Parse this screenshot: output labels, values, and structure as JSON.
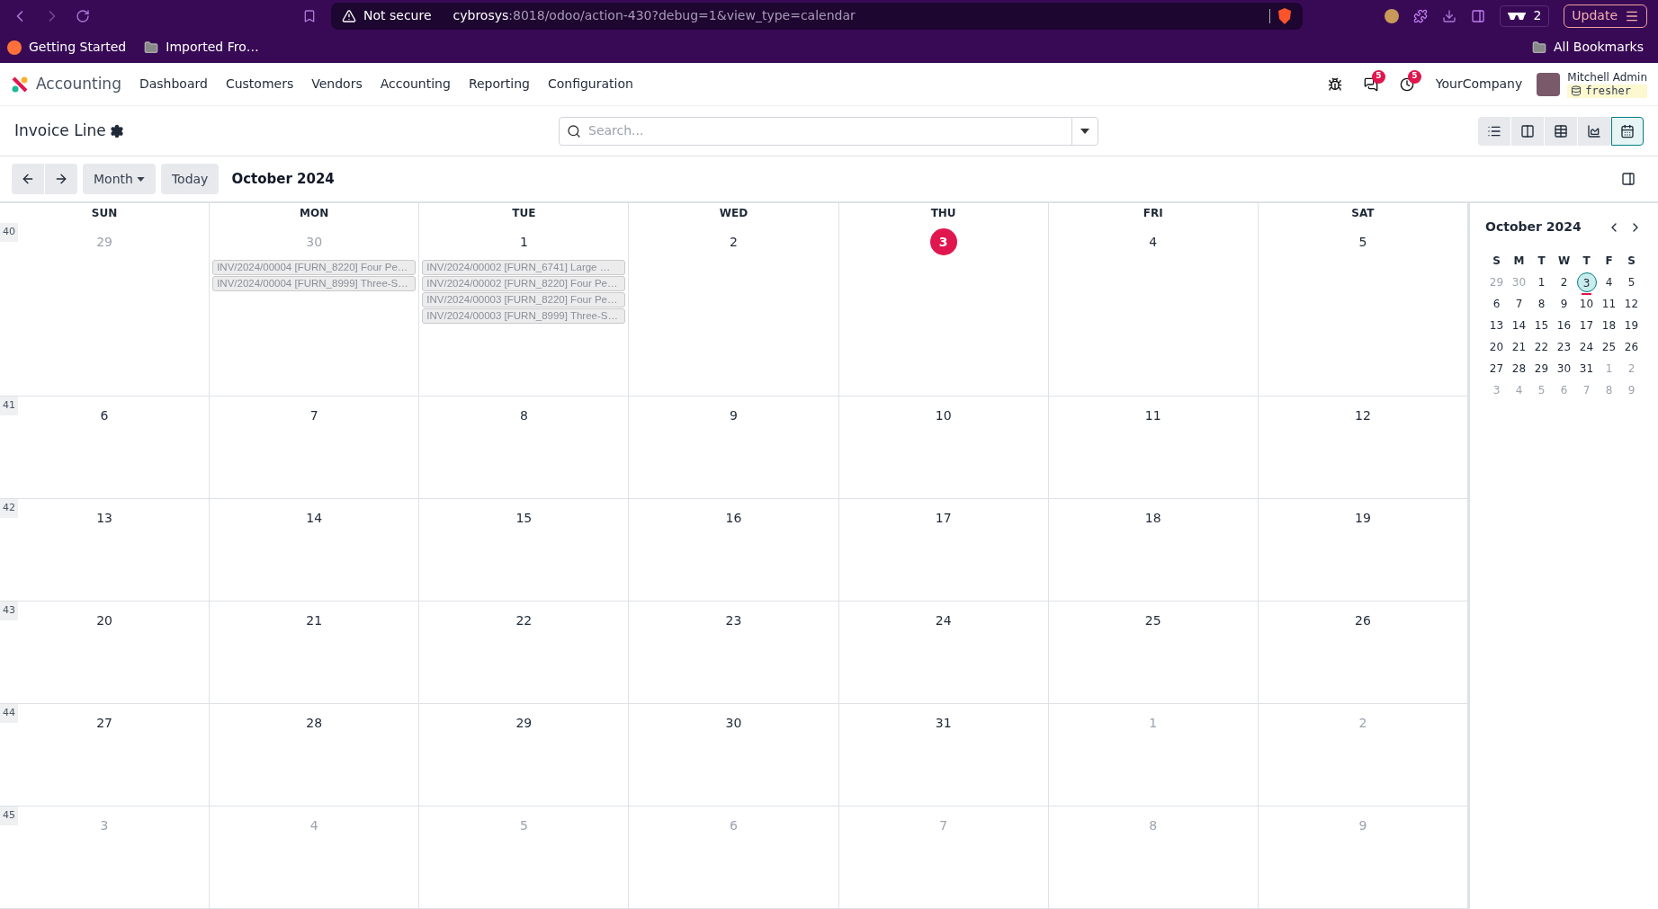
{
  "browser": {
    "security": "Not secure",
    "url_host": "cybrosys",
    "url_rest": ":8018/odoo/action-430?debug=1&view_type=calendar",
    "extension_count": "2",
    "update": "Update",
    "bookmarks": [
      "Getting Started",
      "Imported Fro…"
    ],
    "all_bookmarks": "All Bookmarks"
  },
  "navbar": {
    "app": "Accounting",
    "menus": [
      "Dashboard",
      "Customers",
      "Vendors",
      "Accounting",
      "Reporting",
      "Configuration"
    ],
    "messages_count": "5",
    "activities_count": "5",
    "company": "YourCompany",
    "user": "Mitchell Admin",
    "database": "fresher"
  },
  "control_panel": {
    "title": "Invoice Line",
    "search": {
      "placeholder": "Search..."
    },
    "views": [
      {
        "kind": "list",
        "selected": false
      },
      {
        "kind": "kanban",
        "selected": false
      },
      {
        "kind": "pivot",
        "selected": false
      },
      {
        "kind": "graph",
        "selected": false
      },
      {
        "kind": "calendar",
        "selected": true
      }
    ]
  },
  "toolbar": {
    "scale": "Month",
    "today": "Today",
    "period": "October 2024"
  },
  "calendar": {
    "weekdays": [
      "SUN",
      "MON",
      "TUE",
      "WED",
      "THU",
      "FRI",
      "SAT"
    ],
    "weeks": [
      {
        "number": "40",
        "days": [
          {
            "day": "29",
            "in_month": false,
            "today": false
          },
          {
            "day": "30",
            "in_month": false,
            "today": false,
            "events": [
              "INV/2024/00004 [FURN_8220] Four Pe…",
              "INV/2024/00004 [FURN_8999] Three-S…"
            ]
          },
          {
            "day": "1",
            "in_month": true,
            "today": false,
            "events": [
              "INV/2024/00002 [FURN_6741] Large …",
              "INV/2024/00002 [FURN_8220] Four Pe…",
              "INV/2024/00003 [FURN_8220] Four Pe…",
              "INV/2024/00003 [FURN_8999] Three-S…"
            ]
          },
          {
            "day": "2",
            "in_month": true,
            "today": false
          },
          {
            "day": "3",
            "in_month": true,
            "today": true
          },
          {
            "day": "4",
            "in_month": true,
            "today": false
          },
          {
            "day": "5",
            "in_month": true,
            "today": false
          }
        ]
      },
      {
        "number": "41",
        "days": [
          {
            "day": "6",
            "in_month": true,
            "today": false
          },
          {
            "day": "7",
            "in_month": true,
            "today": false
          },
          {
            "day": "8",
            "in_month": true,
            "today": false
          },
          {
            "day": "9",
            "in_month": true,
            "today": false
          },
          {
            "day": "10",
            "in_month": true,
            "today": false
          },
          {
            "day": "11",
            "in_month": true,
            "today": false
          },
          {
            "day": "12",
            "in_month": true,
            "today": false
          }
        ]
      },
      {
        "number": "42",
        "days": [
          {
            "day": "13",
            "in_month": true,
            "today": false
          },
          {
            "day": "14",
            "in_month": true,
            "today": false
          },
          {
            "day": "15",
            "in_month": true,
            "today": false
          },
          {
            "day": "16",
            "in_month": true,
            "today": false
          },
          {
            "day": "17",
            "in_month": true,
            "today": false
          },
          {
            "day": "18",
            "in_month": true,
            "today": false
          },
          {
            "day": "19",
            "in_month": true,
            "today": false
          }
        ]
      },
      {
        "number": "43",
        "days": [
          {
            "day": "20",
            "in_month": true,
            "today": false
          },
          {
            "day": "21",
            "in_month": true,
            "today": false
          },
          {
            "day": "22",
            "in_month": true,
            "today": false
          },
          {
            "day": "23",
            "in_month": true,
            "today": false
          },
          {
            "day": "24",
            "in_month": true,
            "today": false
          },
          {
            "day": "25",
            "in_month": true,
            "today": false
          },
          {
            "day": "26",
            "in_month": true,
            "today": false
          }
        ]
      },
      {
        "number": "44",
        "days": [
          {
            "day": "27",
            "in_month": true,
            "today": false
          },
          {
            "day": "28",
            "in_month": true,
            "today": false
          },
          {
            "day": "29",
            "in_month": true,
            "today": false
          },
          {
            "day": "30",
            "in_month": true,
            "today": false
          },
          {
            "day": "31",
            "in_month": true,
            "today": false
          },
          {
            "day": "1",
            "in_month": false,
            "today": false
          },
          {
            "day": "2",
            "in_month": false,
            "today": false
          }
        ]
      },
      {
        "number": "45",
        "days": [
          {
            "day": "3",
            "in_month": false,
            "today": false
          },
          {
            "day": "4",
            "in_month": false,
            "today": false
          },
          {
            "day": "5",
            "in_month": false,
            "today": false
          },
          {
            "day": "6",
            "in_month": false,
            "today": false
          },
          {
            "day": "7",
            "in_month": false,
            "today": false
          },
          {
            "day": "8",
            "in_month": false,
            "today": false
          },
          {
            "day": "9",
            "in_month": false,
            "today": false
          }
        ]
      }
    ]
  },
  "mini_calendar": {
    "title": "October 2024",
    "weekdays": [
      "S",
      "M",
      "T",
      "W",
      "T",
      "F",
      "S"
    ],
    "weeks": [
      [
        {
          "day": "29",
          "in_month": false,
          "selected": false,
          "today": false
        },
        {
          "day": "30",
          "in_month": false,
          "selected": false,
          "today": false
        },
        {
          "day": "1",
          "in_month": true,
          "selected": false,
          "today": false
        },
        {
          "day": "2",
          "in_month": true,
          "selected": false,
          "today": false
        },
        {
          "day": "3",
          "in_month": true,
          "selected": true,
          "today": true
        },
        {
          "day": "4",
          "in_month": true,
          "selected": false,
          "today": false
        },
        {
          "day": "5",
          "in_month": true,
          "selected": false,
          "today": false
        }
      ],
      [
        {
          "day": "6",
          "in_month": true,
          "selected": false,
          "today": false
        },
        {
          "day": "7",
          "in_month": true,
          "selected": false,
          "today": false
        },
        {
          "day": "8",
          "in_month": true,
          "selected": false,
          "today": false
        },
        {
          "day": "9",
          "in_month": true,
          "selected": false,
          "today": false
        },
        {
          "day": "10",
          "in_month": true,
          "selected": false,
          "today": false
        },
        {
          "day": "11",
          "in_month": true,
          "selected": false,
          "today": false
        },
        {
          "day": "12",
          "in_month": true,
          "selected": false,
          "today": false
        }
      ],
      [
        {
          "day": "13",
          "in_month": true,
          "selected": false,
          "today": false
        },
        {
          "day": "14",
          "in_month": true,
          "selected": false,
          "today": false
        },
        {
          "day": "15",
          "in_month": true,
          "selected": false,
          "today": false
        },
        {
          "day": "16",
          "in_month": true,
          "selected": false,
          "today": false
        },
        {
          "day": "17",
          "in_month": true,
          "selected": false,
          "today": false
        },
        {
          "day": "18",
          "in_month": true,
          "selected": false,
          "today": false
        },
        {
          "day": "19",
          "in_month": true,
          "selected": false,
          "today": false
        }
      ],
      [
        {
          "day": "20",
          "in_month": true,
          "selected": false,
          "today": false
        },
        {
          "day": "21",
          "in_month": true,
          "selected": false,
          "today": false
        },
        {
          "day": "22",
          "in_month": true,
          "selected": false,
          "today": false
        },
        {
          "day": "23",
          "in_month": true,
          "selected": false,
          "today": false
        },
        {
          "day": "24",
          "in_month": true,
          "selected": false,
          "today": false
        },
        {
          "day": "25",
          "in_month": true,
          "selected": false,
          "today": false
        },
        {
          "day": "26",
          "in_month": true,
          "selected": false,
          "today": false
        }
      ],
      [
        {
          "day": "27",
          "in_month": true,
          "selected": false,
          "today": false
        },
        {
          "day": "28",
          "in_month": true,
          "selected": false,
          "today": false
        },
        {
          "day": "29",
          "in_month": true,
          "selected": false,
          "today": false
        },
        {
          "day": "30",
          "in_month": true,
          "selected": false,
          "today": false
        },
        {
          "day": "31",
          "in_month": true,
          "selected": false,
          "today": false
        },
        {
          "day": "1",
          "in_month": false,
          "selected": false,
          "today": false
        },
        {
          "day": "2",
          "in_month": false,
          "selected": false,
          "today": false
        }
      ],
      [
        {
          "day": "3",
          "in_month": false,
          "selected": false,
          "today": false
        },
        {
          "day": "4",
          "in_month": false,
          "selected": false,
          "today": false
        },
        {
          "day": "5",
          "in_month": false,
          "selected": false,
          "today": false
        },
        {
          "day": "6",
          "in_month": false,
          "selected": false,
          "today": false
        },
        {
          "day": "7",
          "in_month": false,
          "selected": false,
          "today": false
        },
        {
          "day": "8",
          "in_month": false,
          "selected": false,
          "today": false
        },
        {
          "day": "9",
          "in_month": false,
          "selected": false,
          "today": false
        }
      ]
    ]
  }
}
